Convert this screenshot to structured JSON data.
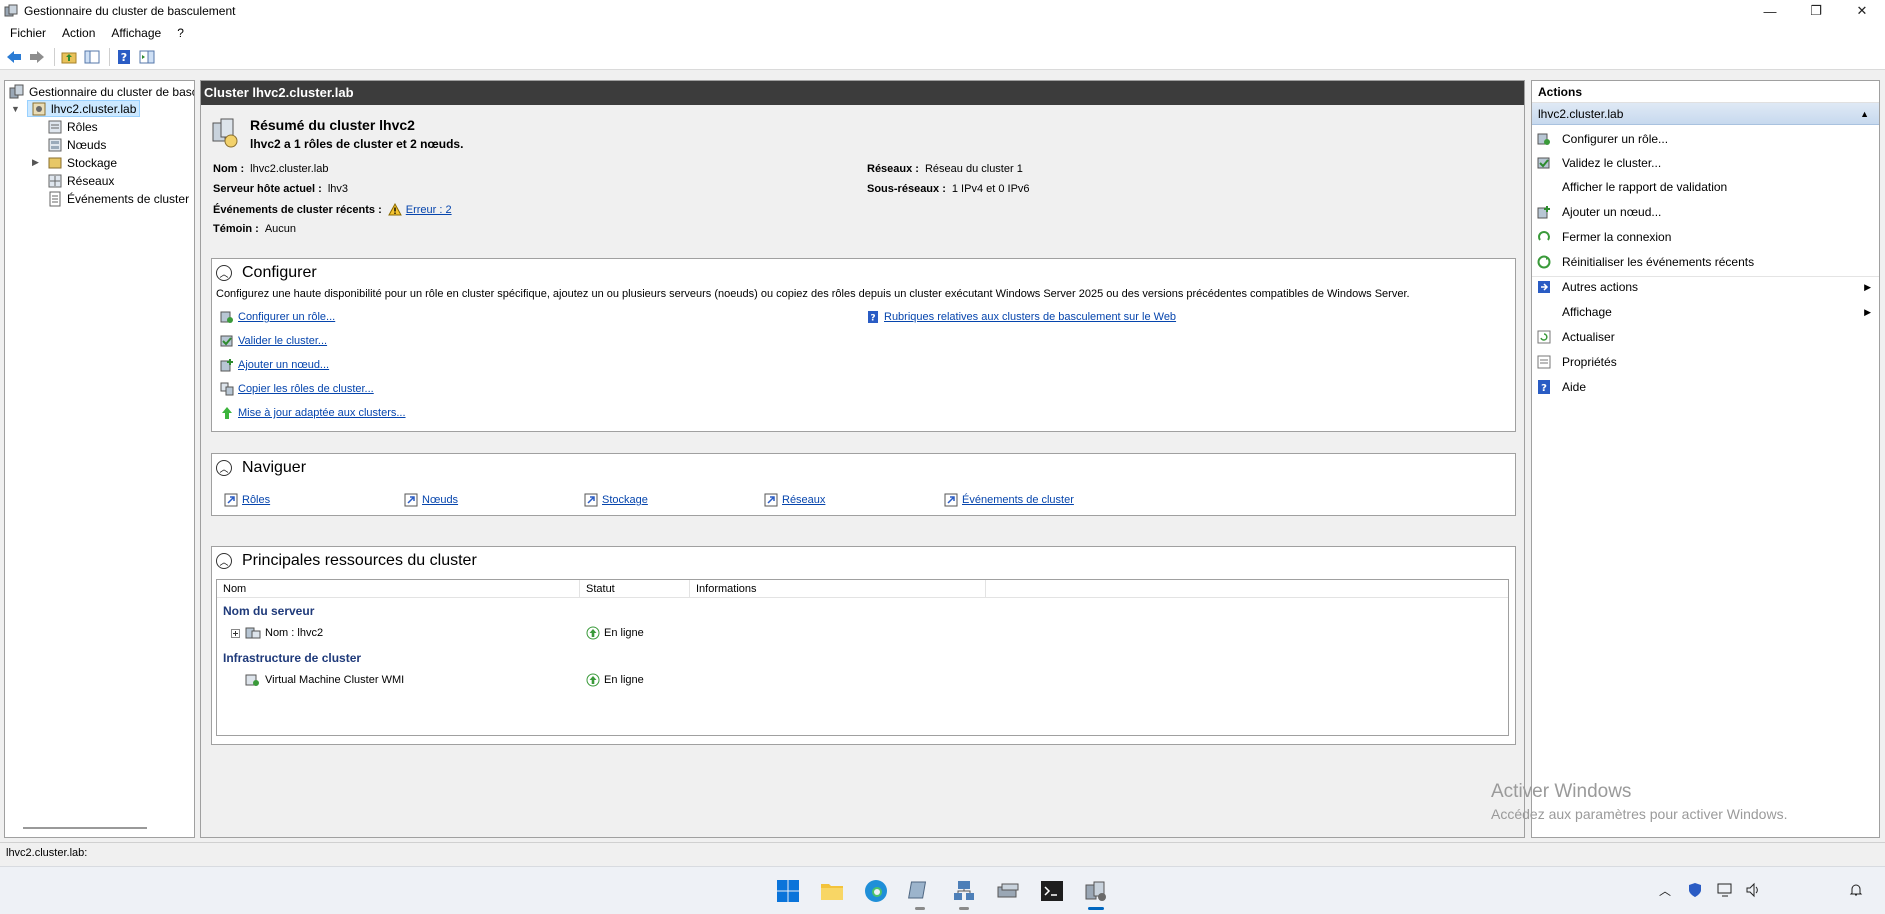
{
  "window": {
    "title": "Gestionnaire du cluster de basculement",
    "controls": [
      "—",
      "❐",
      "✕"
    ]
  },
  "menubar": [
    "Fichier",
    "Action",
    "Affichage",
    "?"
  ],
  "tree": {
    "root": "Gestionnaire du cluster de basc",
    "cluster": "lhvc2.cluster.lab",
    "children": [
      "Rôles",
      "Nœuds",
      "Stockage",
      "Réseaux",
      "Événements de cluster"
    ]
  },
  "center": {
    "header": "Cluster lhvc2.cluster.lab",
    "summary_title": "Résumé du cluster lhvc2",
    "summary_sub": "lhvc2 a 1 rôles de cluster et 2 nœuds.",
    "fields": {
      "nom_label": "Nom :",
      "nom_value": "lhvc2.cluster.lab",
      "serveur_label": "Serveur hôte actuel :",
      "serveur_value": "lhv3",
      "events_label": "Événements de cluster récents :",
      "events_value": "Erreur : 2",
      "temoin_label": "Témoin :",
      "temoin_value": "Aucun",
      "reseaux_label": "Réseaux :",
      "reseaux_value": "Réseau du cluster 1",
      "sousreseaux_label": "Sous-réseaux :",
      "sousreseaux_value": "1 IPv4 et 0 IPv6"
    },
    "configurer": {
      "title": "Configurer",
      "description": "Configurez une haute disponibilité pour un rôle en cluster spécifique, ajoutez un ou plusieurs serveurs (noeuds) ou copiez des rôles depuis un cluster exécutant Windows Server 2025 ou des versions précédentes compatibles de Windows Server.",
      "links": [
        "Configurer un rôle...",
        "Valider le cluster...",
        "Ajouter un nœud...",
        "Copier les rôles de cluster...",
        "Mise à jour adaptée aux clusters..."
      ],
      "web_link": "Rubriques relatives aux clusters de basculement sur le Web"
    },
    "naviguer": {
      "title": "Naviguer",
      "links": [
        "Rôles",
        "Nœuds",
        "Stockage",
        "Réseaux",
        "Événements de cluster"
      ]
    },
    "ressources": {
      "title": "Principales ressources du cluster",
      "columns": [
        "Nom",
        "Statut",
        "Informations"
      ],
      "groups": [
        {
          "name": "Nom du serveur",
          "rows": [
            {
              "name": "Nom : lhvc2",
              "status": "En ligne",
              "info": ""
            }
          ]
        },
        {
          "name": "Infrastructure de cluster",
          "rows": [
            {
              "name": "Virtual Machine Cluster WMI",
              "status": "En ligne",
              "info": ""
            }
          ]
        }
      ]
    }
  },
  "actions": {
    "title": "Actions",
    "context": "lhvc2.cluster.lab",
    "items": [
      "Configurer un rôle...",
      "Validez le cluster...",
      "Afficher le rapport de validation",
      "Ajouter un nœud...",
      "Fermer la connexion",
      "Réinitialiser les événements récents",
      "Autres actions",
      "Affichage",
      "Actualiser",
      "Propriétés",
      "Aide"
    ]
  },
  "watermark": {
    "line1": "Activer Windows",
    "line2": "Accédez aux paramètres pour activer Windows."
  },
  "statusbar": "lhvc2.cluster.lab:",
  "colors": {
    "accent": "#0067c0",
    "header_bg": "#3c3c3c",
    "link": "#0645ad",
    "online_green": "#3a9a3a"
  }
}
